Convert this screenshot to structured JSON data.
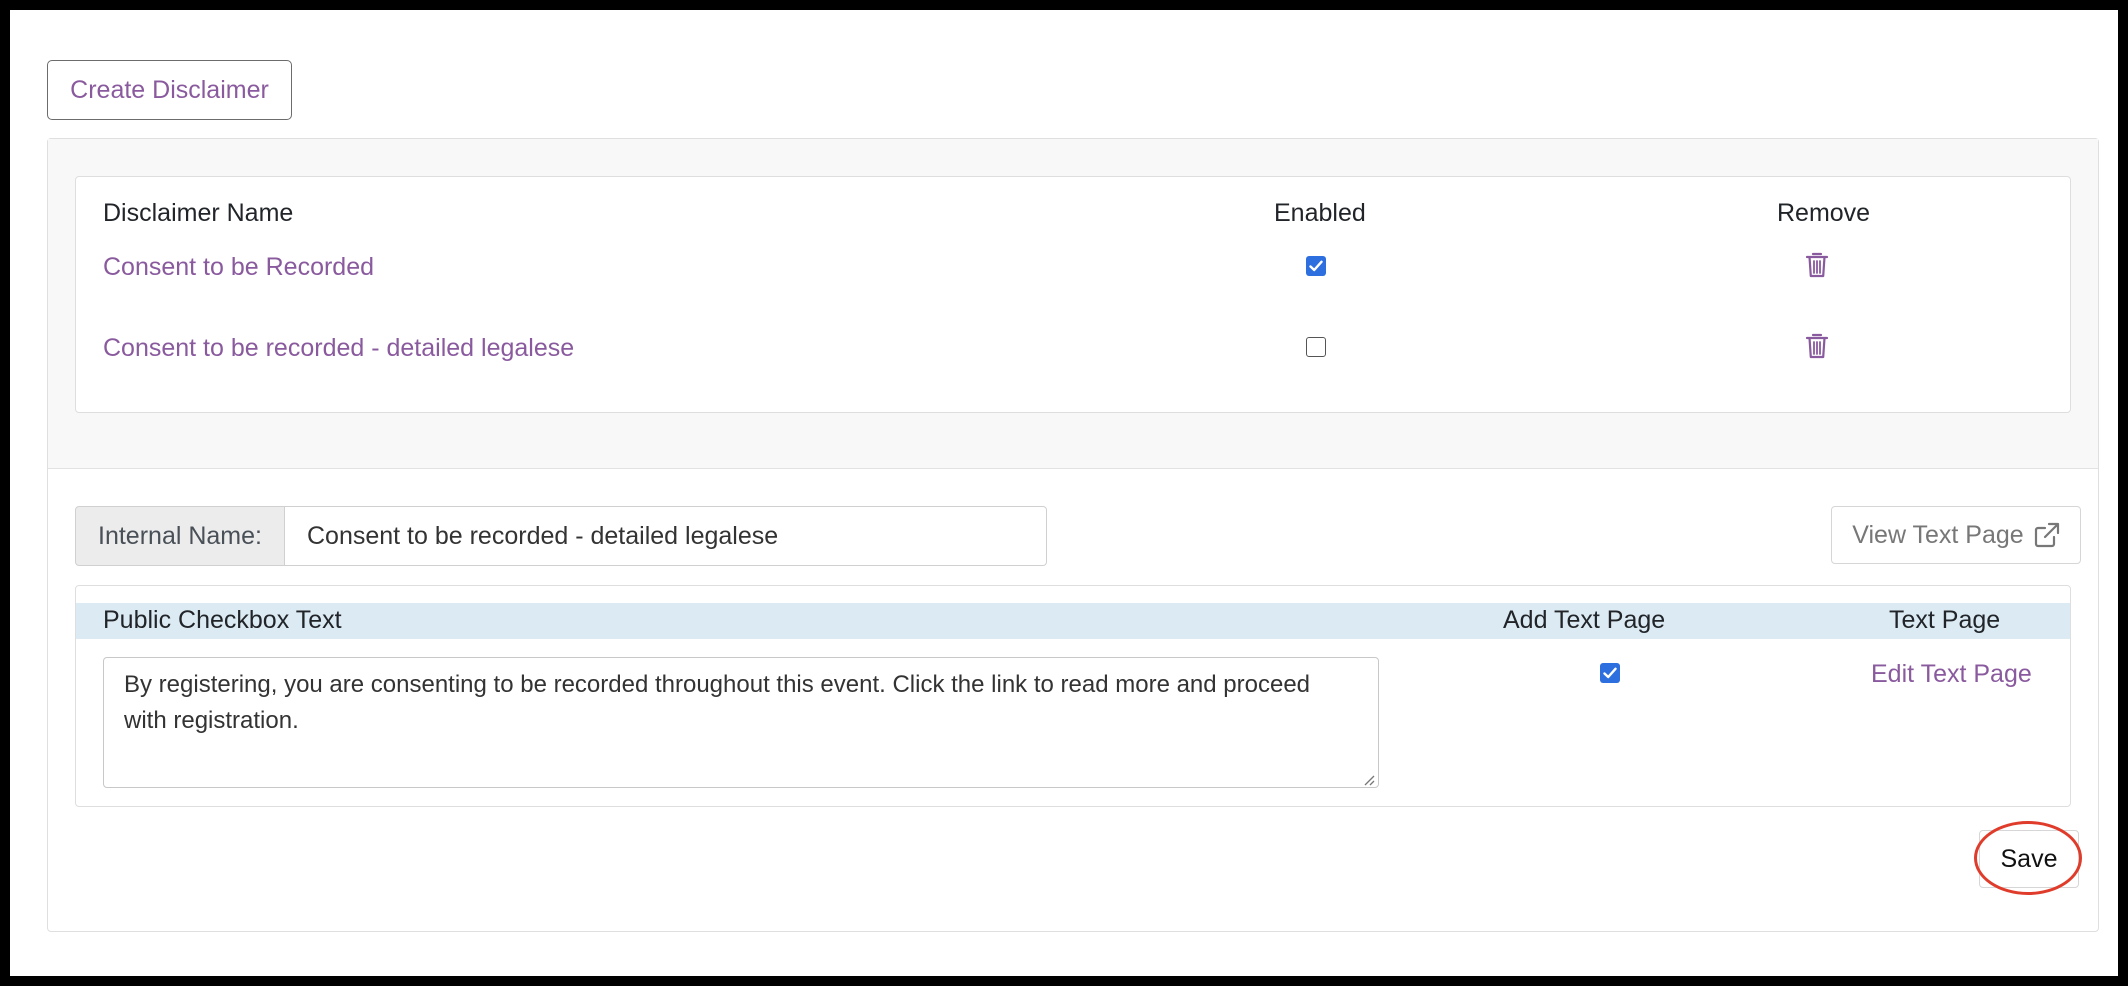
{
  "create_button": "Create Disclaimer",
  "table": {
    "headers": {
      "name": "Disclaimer Name",
      "enabled": "Enabled",
      "remove": "Remove"
    },
    "rows": [
      {
        "name": "Consent to be Recorded",
        "enabled": true
      },
      {
        "name": "Consent to be recorded - detailed legalese",
        "enabled": false
      }
    ]
  },
  "editor": {
    "internal_name_label": "Internal Name:",
    "internal_name_value": "Consent to be recorded - detailed legalese",
    "view_button": "View Text Page",
    "headers": {
      "public_text": "Public Checkbox Text",
      "add_text_page": "Add Text Page",
      "text_page": "Text Page"
    },
    "public_text_value": "By registering, you are consenting to be recorded throughout this event. Click the link to read more and proceed with registration.",
    "add_text_page_checked": true,
    "edit_link": "Edit Text Page",
    "save_button": "Save"
  },
  "colors": {
    "accent": "#8a5a9e",
    "checkbox": "#2e6fe0",
    "highlight": "#e03c2b",
    "header_band": "#dceaf3"
  },
  "icons": [
    "trash-icon",
    "external-link-icon",
    "checkmark-icon",
    "resize-grip-icon"
  ]
}
